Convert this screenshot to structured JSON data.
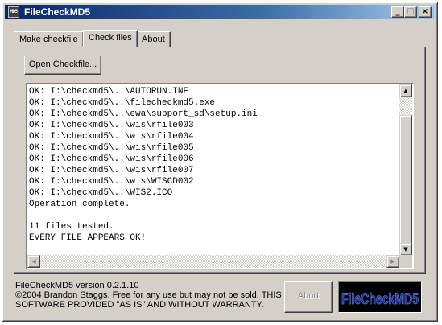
{
  "window": {
    "title": "FileCheckMD5",
    "icon_label": "MD5",
    "icon": "app-icon",
    "controls": {
      "minimize": "_",
      "maximize": "□",
      "close": "×"
    }
  },
  "tabs": [
    {
      "label": "Make checkfile",
      "active": false
    },
    {
      "label": "Check files",
      "active": true
    },
    {
      "label": "About",
      "active": false
    }
  ],
  "open_button": {
    "label": "Open Checkfile..."
  },
  "log": {
    "lines": [
      "OK: I:\\checkmd5\\..\\AUTORUN.INF",
      "OK: I:\\checkmd5\\..\\filecheckmd5.exe",
      "OK: I:\\checkmd5\\..\\ewa\\support_sd\\setup.ini",
      "OK: I:\\checkmd5\\..\\wis\\rfile003",
      "OK: I:\\checkmd5\\..\\wis\\rfile004",
      "OK: I:\\checkmd5\\..\\wis\\rfile005",
      "OK: I:\\checkmd5\\..\\wis\\rfile006",
      "OK: I:\\checkmd5\\..\\wis\\rfile007",
      "OK: I:\\checkmd5\\..\\wis\\WISCD002",
      "OK: I:\\checkmd5\\..\\WIS2.ICO",
      "Operation complete.",
      "",
      "11 files tested.",
      "EVERY FILE APPEARS OK!"
    ],
    "scroll_up": "▲",
    "scroll_down": "▼",
    "scroll_left": "◀",
    "scroll_right": "▶"
  },
  "footer": {
    "version": "FileCheckMD5 version 0.2.1.10",
    "copyright_line1": "©2004 Brandon Staggs. Free for any use but may not be sold. THIS",
    "copyright_line2": "SOFTWARE PROVIDED \"AS IS\" AND WITHOUT WARRANTY.",
    "abort_label": "Abort",
    "logo_text": "FileCheckMD5"
  },
  "colors": {
    "face": "#d4d0c8",
    "titlebar_start": "#0a246a",
    "titlebar_end": "#a6caf0",
    "logo_fill": "#1a2a8c",
    "logo_outline": "#5a7ae0"
  }
}
